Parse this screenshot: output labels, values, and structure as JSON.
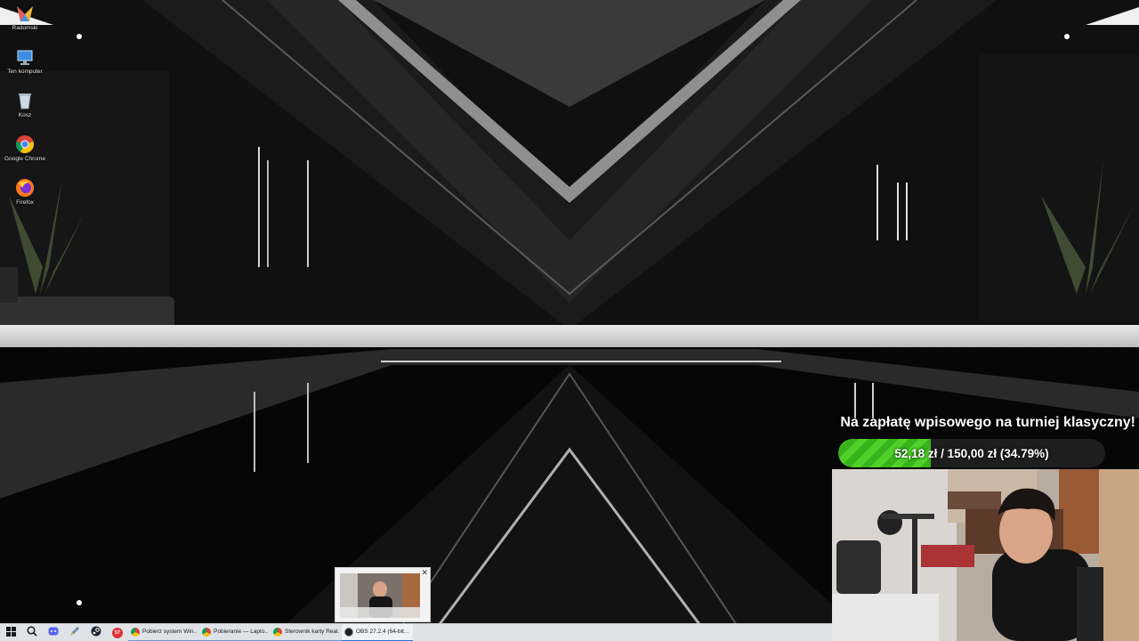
{
  "desktop": {
    "icons": [
      {
        "label": "Radomski",
        "icon": "app-logo-icon"
      },
      {
        "label": "Ten komputer",
        "icon": "computer-icon"
      },
      {
        "label": "Kosz",
        "icon": "recycle-bin-icon"
      },
      {
        "label": "Google Chrome",
        "icon": "chrome-icon"
      },
      {
        "label": "Firefox",
        "icon": "firefox-icon"
      }
    ]
  },
  "goal": {
    "title": "Na zapłatę wpisowego na turniej klasyczny!",
    "progress_text": "52,18 zł / 150,00 zł (34.79%)",
    "current": 52.18,
    "target": 150.0,
    "percent": 34.79,
    "fill_color": "#4fd12a"
  },
  "taskbar": {
    "apps": [
      {
        "label": "Pobierz system Win...",
        "icon": "chrome-icon"
      },
      {
        "label": "Pobieranie — Lapto...",
        "icon": "chrome-icon"
      },
      {
        "label": "Sterownik karty Real...",
        "icon": "chrome-icon"
      },
      {
        "label": "OBS 27.2.4 (64-bit...",
        "icon": "obs-icon"
      }
    ],
    "pinned": [
      "start-icon",
      "search-icon",
      "discord-icon",
      "pen-tool-icon",
      "steam-icon",
      "badge-app-icon"
    ],
    "badge_text": "57"
  },
  "thumbnail": {
    "close_label": "✕"
  }
}
